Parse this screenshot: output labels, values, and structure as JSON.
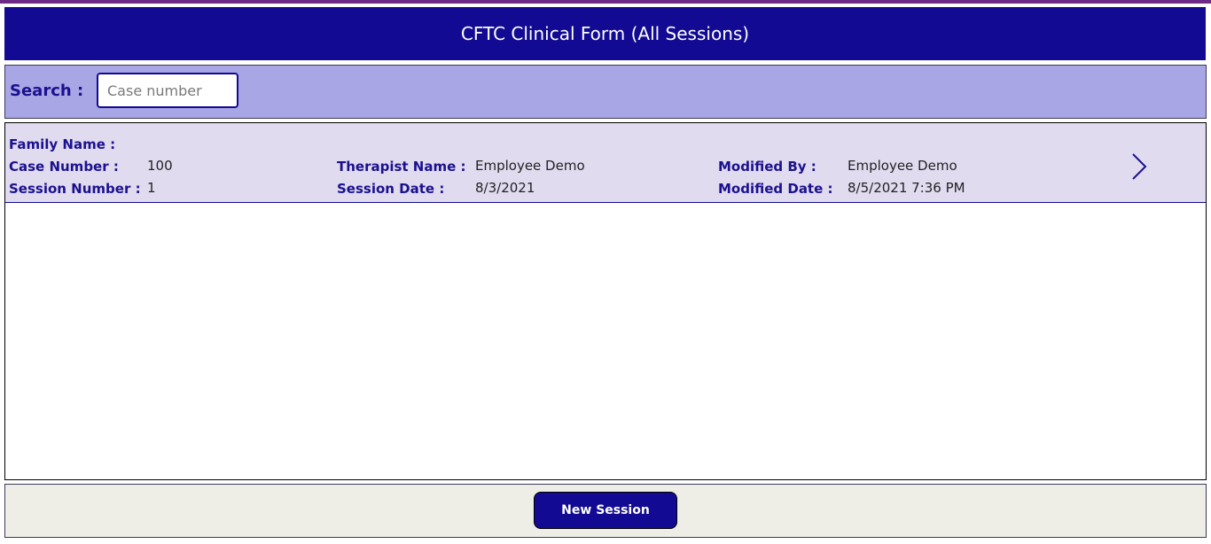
{
  "header": {
    "title": "CFTC Clinical Form (All Sessions)"
  },
  "search": {
    "label": "Search :",
    "placeholder": "Case number",
    "value": ""
  },
  "gallery": {
    "items": [
      {
        "family_name_label": "Family Name :",
        "family_name": "",
        "case_number_label": "Case Number :",
        "case_number": "100",
        "session_number_label": "Session Number :",
        "session_number": "1",
        "therapist_name_label": "Therapist Name :",
        "therapist_name": "Employee Demo",
        "session_date_label": "Session Date :",
        "session_date": "8/3/2021",
        "modified_by_label": "Modified By :",
        "modified_by": "Employee Demo",
        "modified_date_label": "Modified Date :",
        "modified_date": "8/5/2021 7:36 PM",
        "chevron_icon": "chevron-right-icon"
      }
    ]
  },
  "footer": {
    "new_session_label": "New Session"
  },
  "colors": {
    "header_bg": "#120a93",
    "search_bg": "#a9a6e6",
    "row_bg": "#e1dbf0",
    "label_color": "#1b118e",
    "footer_bg": "#eeeee6",
    "accent_line": "#6b2a86"
  }
}
